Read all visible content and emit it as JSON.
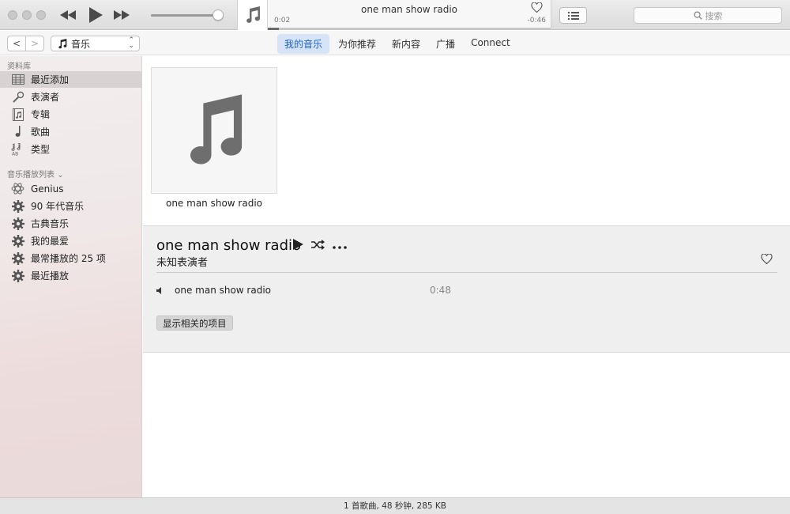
{
  "player": {
    "now_playing_title": "one man show radio",
    "elapsed": "0:02",
    "remaining": "-0:46",
    "progress": 0.04,
    "volume": 0.95,
    "search_placeholder": "搜索"
  },
  "nav": {
    "back": "<",
    "forward": ">",
    "media_type": "音乐",
    "tabs": [
      {
        "label": "我的音乐",
        "active": true
      },
      {
        "label": "为你推荐",
        "active": false
      },
      {
        "label": "新内容",
        "active": false
      },
      {
        "label": "广播",
        "active": false
      },
      {
        "label": "Connect",
        "active": false
      }
    ]
  },
  "sidebar": {
    "library_heading": "资料库",
    "library": [
      {
        "label": "最近添加",
        "icon": "recently-added-icon",
        "selected": true
      },
      {
        "label": "表演者",
        "icon": "microphone-icon",
        "selected": false
      },
      {
        "label": "专辑",
        "icon": "album-icon",
        "selected": false
      },
      {
        "label": "歌曲",
        "icon": "music-note-icon",
        "selected": false
      },
      {
        "label": "类型",
        "icon": "genre-icon",
        "selected": false
      }
    ],
    "playlists_heading": "音乐播放列表",
    "playlists": [
      {
        "label": "Genius",
        "icon": "genius-icon"
      },
      {
        "label": "90 年代音乐",
        "icon": "smart-playlist-gear-icon"
      },
      {
        "label": "古典音乐",
        "icon": "smart-playlist-gear-icon"
      },
      {
        "label": "我的最爱",
        "icon": "smart-playlist-gear-icon"
      },
      {
        "label": "最常播放的 25 项",
        "icon": "smart-playlist-gear-icon"
      },
      {
        "label": "最近播放",
        "icon": "smart-playlist-gear-icon"
      }
    ]
  },
  "main": {
    "album_caption": "one man show radio",
    "detail": {
      "title": "one man show radio",
      "artist": "未知表演者",
      "track": {
        "name": "one man show radio",
        "duration": "0:48"
      },
      "show_related_label": "显示相关的项目"
    }
  },
  "status": {
    "summary": "1 首歌曲, 48 秒钟, 285 KB"
  }
}
